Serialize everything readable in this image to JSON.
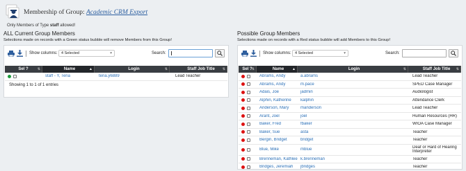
{
  "header": {
    "title_prefix": "Membership of Group: ",
    "group_name": "Academic CRM Export"
  },
  "subnote": {
    "before": "Only Members of Type ",
    "type": "staff",
    "after": " allowed!"
  },
  "left": {
    "title": "ALL Current Group Members",
    "note": "Selections made on records with a Green status bubble will remove Members from this Group!",
    "show_columns_label": "Show columns:",
    "columns_selected": "4 Selected",
    "search_label": "Search:",
    "search_value": "",
    "columns": [
      "Sel ?",
      "Name",
      "Login",
      "Staff Job Title"
    ],
    "rows": [
      {
        "status": "green",
        "name": "staff - Y, Tena",
        "login": "tena.y6889",
        "title": "Lead Teacher"
      }
    ],
    "entries_text": "Showing 1 to 1 of 1 entries"
  },
  "right": {
    "title": "Possible Group Members",
    "note": "Selections made on records with a Red status bubble will add Members to this Group!",
    "show_columns_label": "Show columns:",
    "columns_selected": "4 Selected",
    "search_label": "Search:",
    "search_value": "",
    "columns": [
      "Sel ?",
      "Name",
      "Login",
      "Staff Job Title"
    ],
    "rows": [
      {
        "status": "red",
        "name": "Abrams, Andy",
        "login": "a.abrams",
        "title": "Lead Teacher"
      },
      {
        "status": "red",
        "name": "Abrams, Andy",
        "login": "m.pace",
        "title": "SPED Case Manager"
      },
      {
        "status": "red",
        "name": "Adais, Joe",
        "login": "jadmin",
        "title": "Audiologist"
      },
      {
        "status": "red",
        "name": "Alphin, Katherine",
        "login": "kalphin",
        "title": "Attendance Clerk"
      },
      {
        "status": "red",
        "name": "Anderson, Mary",
        "login": "manderson",
        "title": "Lead Teacher"
      },
      {
        "status": "red",
        "name": "Arant, Joel",
        "login": "joel",
        "title": "Human Resources (HR)"
      },
      {
        "status": "red",
        "name": "Baker, Fred",
        "login": "fbaker",
        "title": "WIOA Case Manager"
      },
      {
        "status": "red",
        "name": "Baker, Sue",
        "login": "asta",
        "title": "Teacher"
      },
      {
        "status": "red",
        "name": "Bergin, Bridget",
        "login": "bridget",
        "title": "Teacher"
      },
      {
        "status": "red",
        "name": "Blue, Mike",
        "login": "mblue",
        "title": "Deaf or Hard of Hearing Interpreter"
      },
      {
        "status": "red",
        "name": "Brenneman, Kathleen",
        "login": "k.brenneman",
        "title": "Teacher"
      },
      {
        "status": "red",
        "name": "Bridges, Jeremiah",
        "login": "jbridges",
        "title": "Teacher"
      }
    ]
  },
  "colors": {
    "header_dark": "#393d42",
    "link": "#2a6fb7",
    "green": "#1c9a3c",
    "red": "#dd1111"
  },
  "icons": [
    "group-icon",
    "print-icon",
    "download-icon",
    "search-icon",
    "sort-icon"
  ]
}
